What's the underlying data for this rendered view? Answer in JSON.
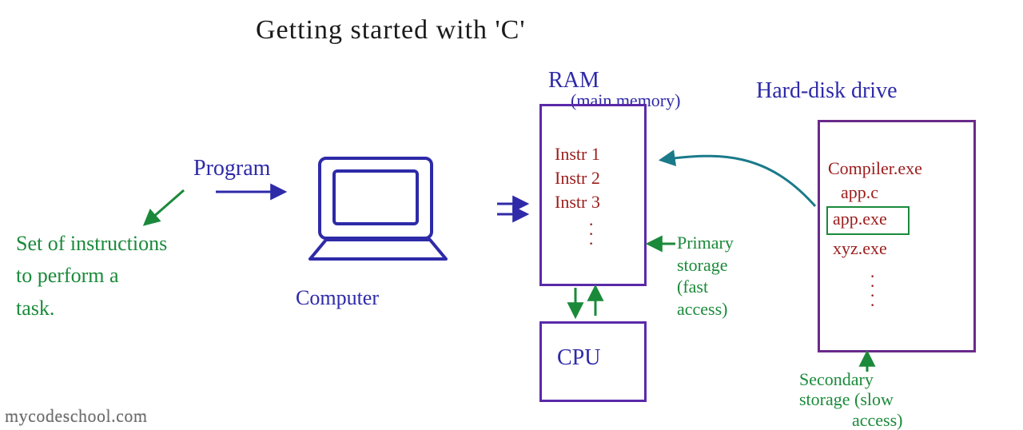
{
  "title": "Getting started with 'C'",
  "program_label": "Program",
  "instructions_note": "Set of instructions\nto perform a\ntask.",
  "computer_label": "Computer",
  "ram": {
    "title": "RAM",
    "subtitle": "(main memory)",
    "items": [
      "Instr 1",
      "Instr 2",
      "Instr 3"
    ]
  },
  "cpu_label": "CPU",
  "primary_storage_label": "Primary\nstorage\n(fast\naccess)",
  "hdd": {
    "title": "Hard-disk drive",
    "files": [
      "Compiler.exe",
      "app.c",
      "app.exe",
      "xyz.exe"
    ]
  },
  "secondary_storage_label": "Secondary\nstorage (slow\n            access)",
  "watermark": "mycodeschool.com"
}
